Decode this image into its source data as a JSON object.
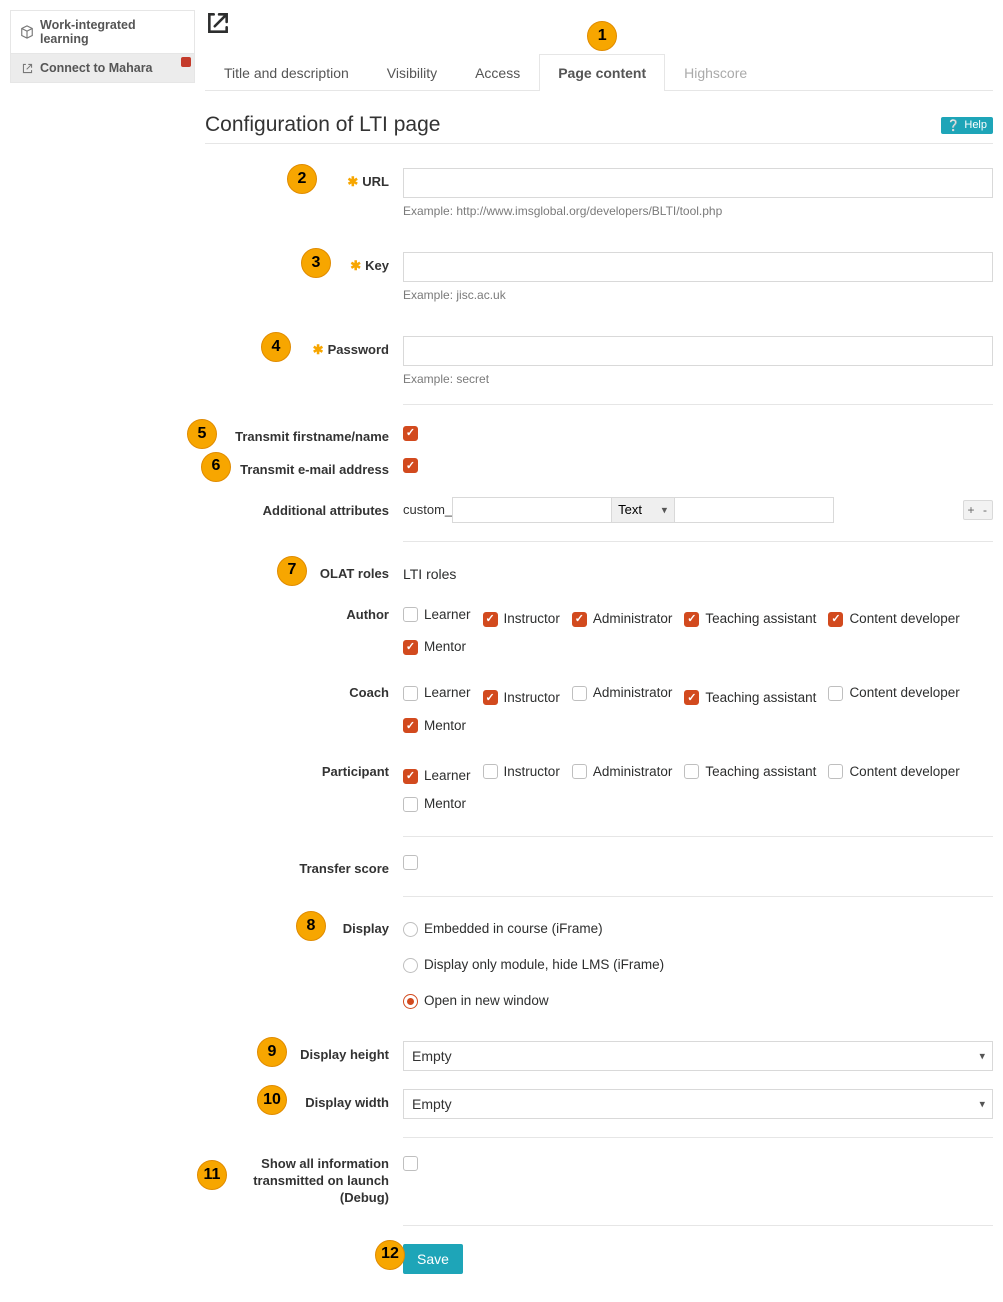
{
  "sidebar": {
    "items": [
      {
        "label": "Work-integrated learning",
        "name": "sidebar-item-wil",
        "active": false,
        "icon": "cube",
        "alert": false
      },
      {
        "label": "Connect to Mahara",
        "name": "sidebar-item-mahara",
        "active": true,
        "icon": "external",
        "alert": true
      }
    ]
  },
  "tabs": {
    "items": [
      {
        "label": "Title and description",
        "name": "tab-title-description",
        "active": false
      },
      {
        "label": "Visibility",
        "name": "tab-visibility",
        "active": false
      },
      {
        "label": "Access",
        "name": "tab-access",
        "active": false
      },
      {
        "label": "Page content",
        "name": "tab-page-content",
        "active": true,
        "badge": "1"
      },
      {
        "label": "Highscore",
        "name": "tab-highscore",
        "active": false,
        "muted": true
      }
    ]
  },
  "header": {
    "title": "Configuration of LTI page",
    "help_label": "Help"
  },
  "form": {
    "url": {
      "label": "URL",
      "value": "",
      "hint": "Example: http://www.imsglobal.org/developers/BLTI/tool.php",
      "badge": "2",
      "required": true
    },
    "key": {
      "label": "Key",
      "value": "",
      "hint": "Example: jisc.ac.uk",
      "badge": "3",
      "required": true
    },
    "password": {
      "label": "Password",
      "value": "",
      "hint": "Example: secret",
      "badge": "4",
      "required": true
    },
    "transmit_name": {
      "label": "Transmit firstname/name",
      "checked": true,
      "badge": "5"
    },
    "transmit_email": {
      "label": "Transmit e-mail address",
      "checked": true,
      "badge": "6"
    },
    "additional_attributes": {
      "label": "Additional attributes",
      "prefix": "custom_",
      "key_value": "",
      "type_options": [
        "Text"
      ],
      "type_selected": "Text",
      "value_value": ""
    },
    "roles": {
      "header_label": "OLAT roles",
      "header_value": "LTI roles",
      "header_badge": "7",
      "roles_list": [
        "Learner",
        "Instructor",
        "Administrator",
        "Teaching assistant",
        "Content developer",
        "Mentor"
      ],
      "rows": [
        {
          "label": "Author",
          "checked": [
            false,
            true,
            true,
            true,
            true,
            true
          ]
        },
        {
          "label": "Coach",
          "checked": [
            false,
            true,
            false,
            true,
            false,
            true
          ]
        },
        {
          "label": "Participant",
          "checked": [
            true,
            false,
            false,
            false,
            false,
            false
          ]
        }
      ]
    },
    "transfer_score": {
      "label": "Transfer score",
      "checked": false
    },
    "display": {
      "label": "Display",
      "badge": "8",
      "options": [
        {
          "label": "Embedded in course (iFrame)",
          "selected": false
        },
        {
          "label": "Display only module, hide LMS (iFrame)",
          "selected": false
        },
        {
          "label": "Open in new window",
          "selected": true
        }
      ]
    },
    "display_height": {
      "label": "Display height",
      "selected": "Empty",
      "badge": "9"
    },
    "display_width": {
      "label": "Display width",
      "selected": "Empty",
      "badge": "10"
    },
    "debug": {
      "label": "Show all information transmitted on launch (Debug)",
      "checked": false,
      "badge": "11"
    },
    "save": {
      "label": "Save",
      "badge": "12"
    }
  }
}
